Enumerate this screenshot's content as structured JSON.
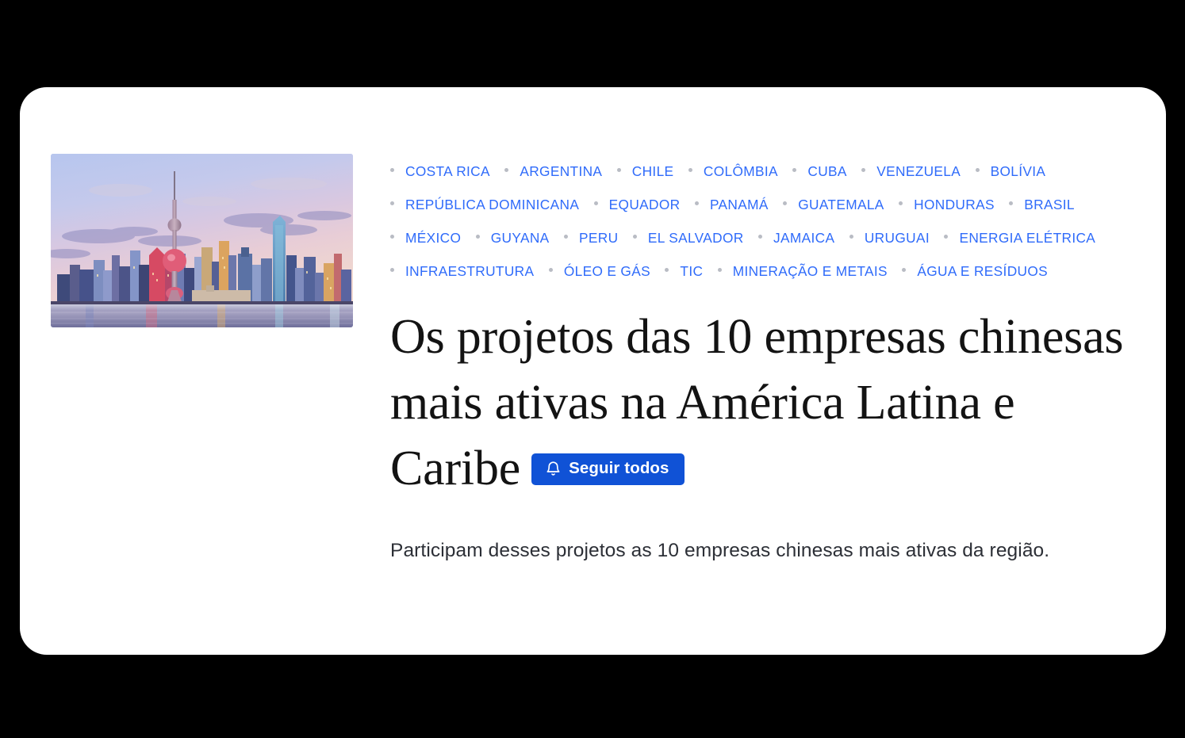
{
  "card": {
    "background_color": "#ffffff",
    "page_background_color": "#000000"
  },
  "thumbnail": {
    "name": "shanghai-pudong-skyline-at-sunset",
    "alt": "Skyline de Xangai com a Torre Pérola Oriental ao pôr do sol"
  },
  "tags": {
    "accent_color": "#2f6bfa",
    "bullet_color": "#b9bcc4",
    "items": [
      {
        "label": "COSTA RICA"
      },
      {
        "label": "ARGENTINA"
      },
      {
        "label": "CHILE"
      },
      {
        "label": "COLÔMBIA"
      },
      {
        "label": "CUBA"
      },
      {
        "label": "VENEZUELA"
      },
      {
        "label": "BOLÍVIA"
      },
      {
        "label": "REPÚBLICA DOMINICANA"
      },
      {
        "label": "EQUADOR"
      },
      {
        "label": "PANAMÁ"
      },
      {
        "label": "GUATEMALA"
      },
      {
        "label": "HONDURAS"
      },
      {
        "label": "BRASIL"
      },
      {
        "label": "MÉXICO"
      },
      {
        "label": "GUYANA"
      },
      {
        "label": "PERU"
      },
      {
        "label": "EL SALVADOR"
      },
      {
        "label": "JAMAICA"
      },
      {
        "label": "URUGUAI"
      },
      {
        "label": "ENERGIA ELÉTRICA"
      },
      {
        "label": "INFRAESTRUTURA"
      },
      {
        "label": "ÓLEO E GÁS"
      },
      {
        "label": "TIC"
      },
      {
        "label": "MINERAÇÃO E METAIS"
      },
      {
        "label": "ÁGUA E RESÍDUOS"
      }
    ]
  },
  "article": {
    "headline": "Os projetos das 10 empresas chinesas mais ativas na América Latina e Caribe",
    "subtitle": "Participam desses projetos as 10 empresas chinesas mais ativas da região."
  },
  "follow_button": {
    "label": "Seguir todos",
    "icon": "bell-icon",
    "background_color": "#1052d6",
    "text_color": "#ffffff"
  }
}
